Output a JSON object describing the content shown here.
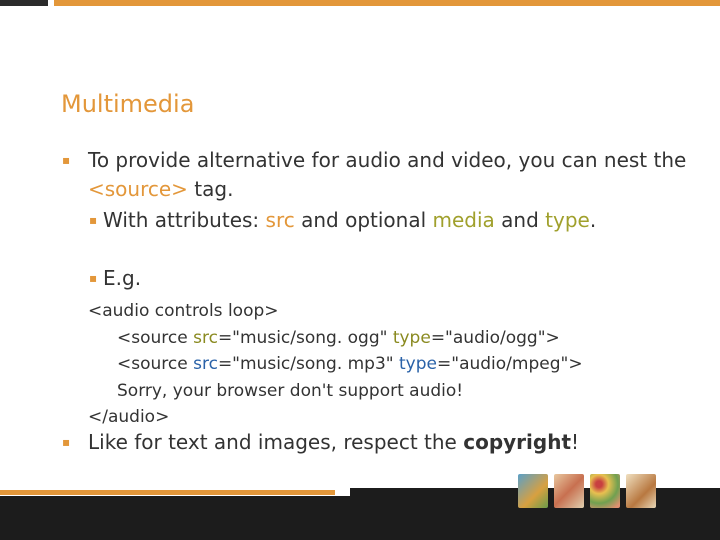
{
  "slide": {
    "title": "Multimedia",
    "bullets": {
      "b1_text_1": "To provide alternative for audio and video, you can nest the ",
      "b1_source_tag": "<source>",
      "b1_text_2": " tag.",
      "sub1_text_1": "With attributes: ",
      "sub1_src": "src",
      "sub1_text_2": " and optional ",
      "sub1_media": "media",
      "sub1_text_3": " and ",
      "sub1_type": "type",
      "sub1_text_4": ".",
      "sub2_text": "E.g.",
      "b2_text_1": "Like for text and images, respect the ",
      "b2_copyright": "copyright",
      "b2_text_2": "!"
    },
    "code": {
      "line1": "<audio controls loop>",
      "line2_open": "<source ",
      "line2_attr1": "src",
      "line2_val1": "=\"music/song. ogg\" ",
      "line2_attr2": "type",
      "line2_val2": "=\"audio/ogg\">",
      "line3_open": "<source ",
      "line3_attr1": "src",
      "line3_val1": "=\"music/song. mp3\" ",
      "line3_attr2": "type",
      "line3_val2": "=\"audio/mpeg\">",
      "line4": "Sorry, your browser don't support audio!",
      "line5": "</audio>"
    }
  },
  "colors": {
    "accent": "#e3973a",
    "olive": "#a0a02c",
    "blue": "#2a62a8",
    "dark": "#1c1c1c"
  },
  "icons": {
    "bullet_marker": "square-bullet-icon"
  }
}
